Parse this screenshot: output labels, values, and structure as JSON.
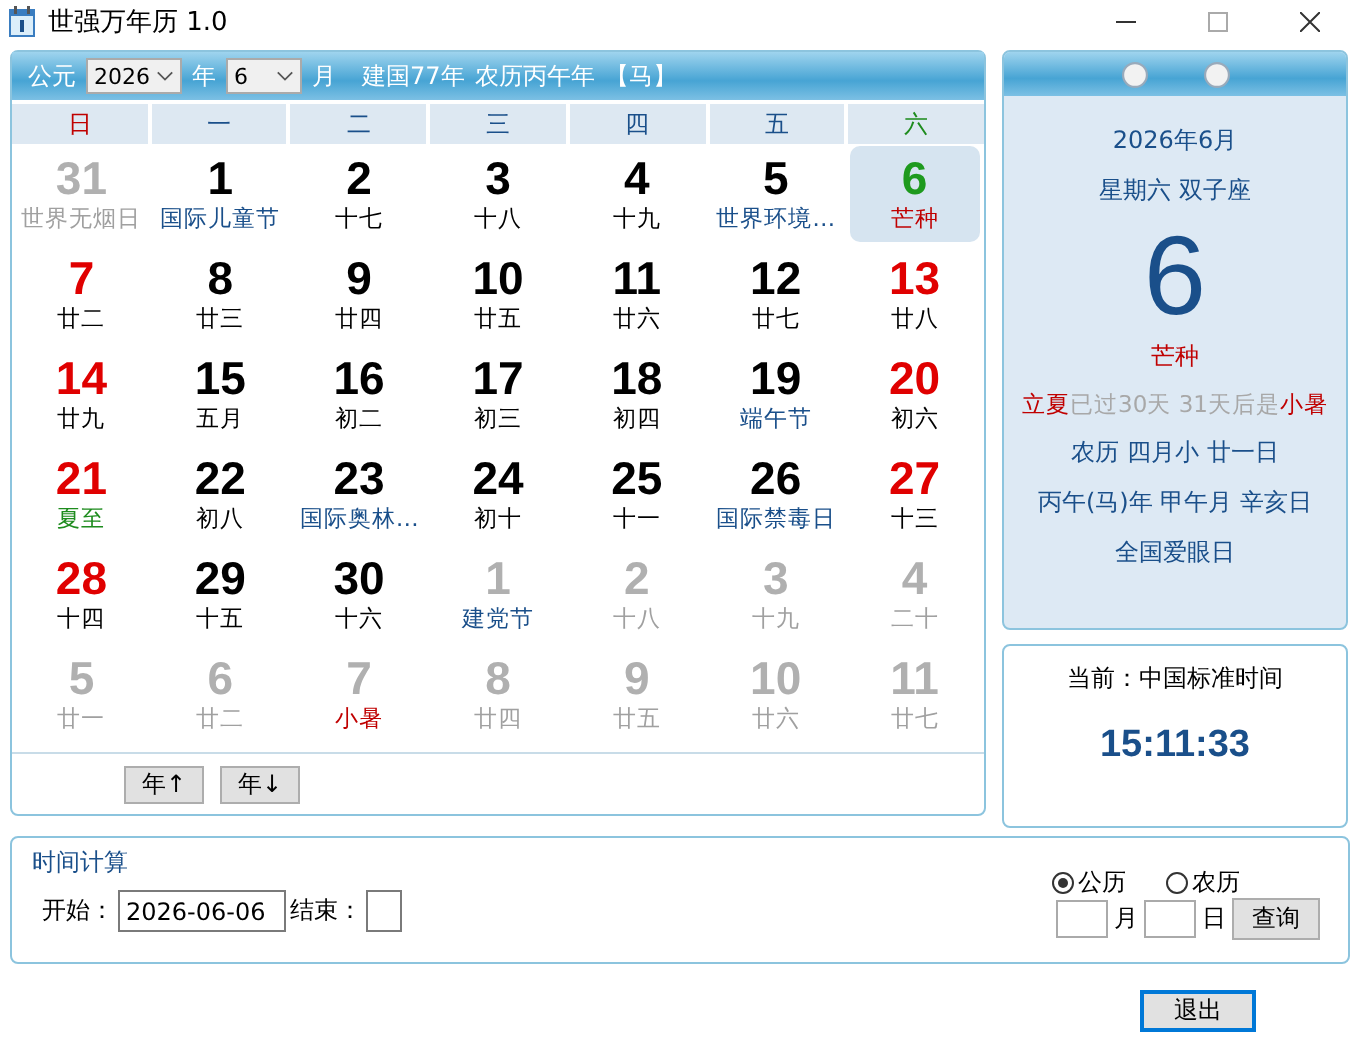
{
  "window": {
    "title": "世强万年历 1.0"
  },
  "header": {
    "era": "公元",
    "year": "2026",
    "year_unit": "年",
    "month": "6",
    "month_unit": "月",
    "founding": "建国77年",
    "lunar_year": "农历丙午年",
    "zodiac": "【马】"
  },
  "weekdays": [
    {
      "label": "日",
      "kind": "sun"
    },
    {
      "label": "一",
      "kind": "week"
    },
    {
      "label": "二",
      "kind": "week"
    },
    {
      "label": "三",
      "kind": "week"
    },
    {
      "label": "四",
      "kind": "week"
    },
    {
      "label": "五",
      "kind": "week"
    },
    {
      "label": "六",
      "kind": "sat"
    }
  ],
  "weeks": [
    [
      {
        "day": "31",
        "note": "世界无烟日",
        "kind": "other",
        "color": "#a0a0a0",
        "selected": false
      },
      {
        "day": "1",
        "note": "国际儿童节",
        "kind": "week",
        "color": "#1a4f8a",
        "selected": false
      },
      {
        "day": "2",
        "note": "十七",
        "kind": "week",
        "color": "#000000",
        "selected": false
      },
      {
        "day": "3",
        "note": "十八",
        "kind": "week",
        "color": "#000000",
        "selected": false
      },
      {
        "day": "4",
        "note": "十九",
        "kind": "week",
        "color": "#000000",
        "selected": false
      },
      {
        "day": "5",
        "note": "世界环境…",
        "kind": "week",
        "color": "#1a4f8a",
        "selected": false
      },
      {
        "day": "6",
        "note": "芒种",
        "kind": "weekend",
        "color": "#c00000",
        "selected": true
      }
    ],
    [
      {
        "day": "7",
        "note": "廿二",
        "kind": "weekend",
        "color": "#000000",
        "selected": false
      },
      {
        "day": "8",
        "note": "廿三",
        "kind": "week",
        "color": "#000000",
        "selected": false
      },
      {
        "day": "9",
        "note": "廿四",
        "kind": "week",
        "color": "#000000",
        "selected": false
      },
      {
        "day": "10",
        "note": "廿五",
        "kind": "week",
        "color": "#000000",
        "selected": false
      },
      {
        "day": "11",
        "note": "廿六",
        "kind": "week",
        "color": "#000000",
        "selected": false
      },
      {
        "day": "12",
        "note": "廿七",
        "kind": "week",
        "color": "#000000",
        "selected": false
      },
      {
        "day": "13",
        "note": "廿八",
        "kind": "weekend",
        "color": "#000000",
        "selected": false
      }
    ],
    [
      {
        "day": "14",
        "note": "廿九",
        "kind": "weekend",
        "color": "#000000",
        "selected": false
      },
      {
        "day": "15",
        "note": "五月",
        "kind": "week",
        "color": "#000000",
        "selected": false
      },
      {
        "day": "16",
        "note": "初二",
        "kind": "week",
        "color": "#000000",
        "selected": false
      },
      {
        "day": "17",
        "note": "初三",
        "kind": "week",
        "color": "#000000",
        "selected": false
      },
      {
        "day": "18",
        "note": "初四",
        "kind": "week",
        "color": "#000000",
        "selected": false
      },
      {
        "day": "19",
        "note": "端午节",
        "kind": "week",
        "color": "#1a4f8a",
        "selected": false
      },
      {
        "day": "20",
        "note": "初六",
        "kind": "weekend",
        "color": "#000000",
        "selected": false
      }
    ],
    [
      {
        "day": "21",
        "note": "夏至",
        "kind": "weekend",
        "color": "#1e8c1e",
        "selected": false
      },
      {
        "day": "22",
        "note": "初八",
        "kind": "week",
        "color": "#000000",
        "selected": false
      },
      {
        "day": "23",
        "note": "国际奥林…",
        "kind": "week",
        "color": "#1a4f8a",
        "selected": false
      },
      {
        "day": "24",
        "note": "初十",
        "kind": "week",
        "color": "#000000",
        "selected": false
      },
      {
        "day": "25",
        "note": "十一",
        "kind": "week",
        "color": "#000000",
        "selected": false
      },
      {
        "day": "26",
        "note": "国际禁毒日",
        "kind": "week",
        "color": "#1a4f8a",
        "selected": false
      },
      {
        "day": "27",
        "note": "十三",
        "kind": "weekend",
        "color": "#000000",
        "selected": false
      }
    ],
    [
      {
        "day": "28",
        "note": "十四",
        "kind": "weekend",
        "color": "#000000",
        "selected": false
      },
      {
        "day": "29",
        "note": "十五",
        "kind": "week",
        "color": "#000000",
        "selected": false
      },
      {
        "day": "30",
        "note": "十六",
        "kind": "week",
        "color": "#000000",
        "selected": false
      },
      {
        "day": "1",
        "note": "建党节",
        "kind": "other",
        "color": "#1a4f8a",
        "selected": false
      },
      {
        "day": "2",
        "note": "十八",
        "kind": "other",
        "color": "#a0a0a0",
        "selected": false
      },
      {
        "day": "3",
        "note": "十九",
        "kind": "other",
        "color": "#a0a0a0",
        "selected": false
      },
      {
        "day": "4",
        "note": "二十",
        "kind": "other",
        "color": "#a0a0a0",
        "selected": false
      }
    ],
    [
      {
        "day": "5",
        "note": "廿一",
        "kind": "other",
        "color": "#a0a0a0",
        "selected": false
      },
      {
        "day": "6",
        "note": "廿二",
        "kind": "other",
        "color": "#a0a0a0",
        "selected": false
      },
      {
        "day": "7",
        "note": "小暑",
        "kind": "other",
        "color": "#c00000",
        "selected": false
      },
      {
        "day": "8",
        "note": "廿四",
        "kind": "other",
        "color": "#a0a0a0",
        "selected": false
      },
      {
        "day": "9",
        "note": "廿五",
        "kind": "other",
        "color": "#a0a0a0",
        "selected": false
      },
      {
        "day": "10",
        "note": "廿六",
        "kind": "other",
        "color": "#a0a0a0",
        "selected": false
      },
      {
        "day": "11",
        "note": "廿七",
        "kind": "other",
        "color": "#a0a0a0",
        "selected": false
      }
    ]
  ],
  "nav_buttons": [
    "年↑",
    "年↓"
  ],
  "day_card": {
    "month_line": "2026年6月",
    "weekday_line": "星期六  双子座",
    "day": "6",
    "term": "芒种",
    "prev_term": "立夏",
    "passed": "已过30天",
    "until": "31天后是",
    "next_term": "小暑",
    "lunar_line": "农历   四月小  廿一日",
    "ganzhi_line": "丙午(马)年  甲午月  辛亥日",
    "festival": "全国爱眼日"
  },
  "clock": {
    "zone": "当前：中国标准时间",
    "time": "15:11:33"
  },
  "time_calc": {
    "title": "时间计算",
    "start_label": "开始：",
    "start": "2026-06-06",
    "end_label": "结束：",
    "calendars": [
      {
        "label": "公历",
        "selected": true
      },
      {
        "label": "农历",
        "selected": false
      }
    ],
    "units": [
      "月",
      "日"
    ],
    "query": "查询"
  },
  "exit": "退出"
}
